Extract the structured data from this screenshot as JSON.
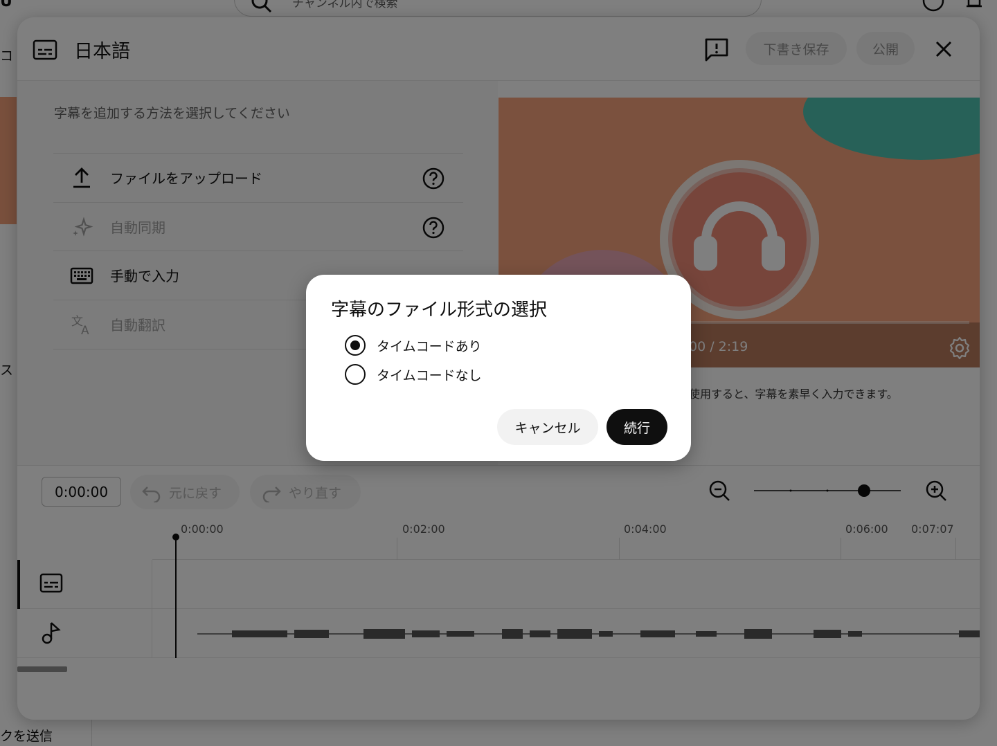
{
  "background": {
    "search_placeholder": "チャンネル内で検索",
    "left_text_1": "コ",
    "left_text_2": "ス",
    "feedback_text": "クを送信"
  },
  "editor": {
    "title": "日本語",
    "save_draft_label": "下書き保存",
    "publish_label": "公開",
    "method_prompt": "字幕を追加する方法を選択してください",
    "methods": [
      {
        "label": "ファイルをアップロード",
        "icon": "upload-icon",
        "enabled": true
      },
      {
        "label": "自動同期",
        "icon": "sparkle-icon",
        "enabled": false
      },
      {
        "label": "手動で入力",
        "icon": "keyboard-icon",
        "enabled": true
      },
      {
        "label": "自動翻訳",
        "icon": "translate-icon",
        "enabled": false
      }
    ],
    "video_time": "00 / 2:19",
    "video_hint": "使用すると、字幕を素早く入力できます。",
    "timecode_value": "0:00:00",
    "undo_label": "元に戻す",
    "redo_label": "やり直す",
    "zoom_level_fraction": 0.75,
    "ruler_ticks": [
      "0:00:00",
      "0:02:00",
      "0:04:00",
      "0:06:00",
      "0:07:07"
    ]
  },
  "dialog": {
    "title": "字幕のファイル形式の選択",
    "options": [
      {
        "label": "タイムコードあり",
        "checked": true
      },
      {
        "label": "タイムコードなし",
        "checked": false
      }
    ],
    "cancel_label": "キャンセル",
    "continue_label": "続行"
  },
  "colors": {
    "accent": "#0f0f0f",
    "thumbnail_bg": "#f7a37c",
    "thumbnail_teal": "#4fc3b0",
    "thumbnail_circle": "#ef8a77"
  }
}
